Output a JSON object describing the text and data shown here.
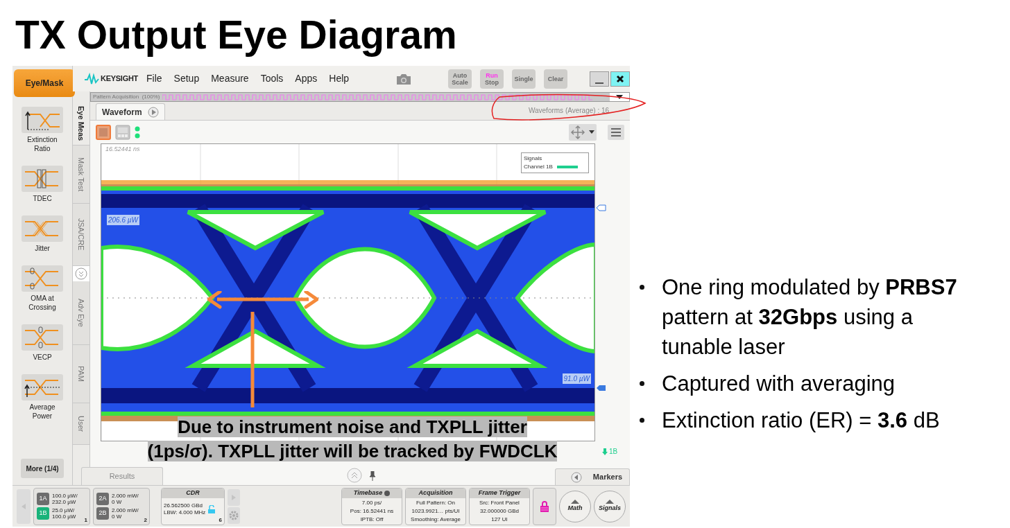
{
  "slide": {
    "title": "TX Output Eye Diagram",
    "bullets": [
      "One ring modulated by **PRBS7** pattern at **32Gbps** using a tunable laser",
      "Captured with averaging",
      "Extinction ratio (ER) = **3.6** dB"
    ],
    "annotation": {
      "lines": [
        "Due to instrument noise and TXPLL jitter",
        "(1ps/σ). TXPLL jitter will be tracked by FWDCLK"
      ]
    }
  },
  "app": {
    "mode_button": "Eye/Mask",
    "logo": "KEYSIGHT",
    "menu": [
      "File",
      "Setup",
      "Measure",
      "Tools",
      "Apps",
      "Help"
    ],
    "buttons": [
      {
        "kind": "plain",
        "lines": [
          "Auto",
          "Scale"
        ]
      },
      {
        "kind": "run_stop",
        "lines": [
          "Run",
          "Stop"
        ],
        "running": true
      },
      {
        "kind": "plain",
        "lines": [
          "Single"
        ]
      },
      {
        "kind": "plain",
        "lines": [
          "Clear"
        ]
      }
    ],
    "measurements": [
      {
        "label": "Extinction Ratio",
        "kind": "extinction"
      },
      {
        "label": "TDEC",
        "kind": "tdec"
      },
      {
        "label": "Jitter",
        "kind": "jitter"
      },
      {
        "label": "OMA at Crossing",
        "kind": "oma"
      },
      {
        "label": "VECP",
        "kind": "vecp"
      },
      {
        "label": "Average Power",
        "kind": "power"
      }
    ],
    "more_button": "More (1/4)",
    "side_tabs": [
      {
        "label": "Eye Meas",
        "selected": true
      },
      {
        "label": "Mask Test",
        "selected": false
      },
      {
        "label": "JSA/CRE",
        "selected": false
      },
      {
        "label": "Adv Eye",
        "selected": false
      },
      {
        "label": "PAM",
        "selected": false
      },
      {
        "label": "User",
        "selected": false
      }
    ],
    "acquisition_bar": "Pattern Acquisition  (100%)",
    "tab": "Waveform",
    "waveform_status": "Waveforms (Average) : 16",
    "plot": {
      "time_label": "16.52441 ns",
      "legend_title": "Signals",
      "legend_items": [
        {
          "label": "Channel 1B",
          "color": "#1fcf8f"
        }
      ],
      "markers": [
        "206.6 µW",
        "91.0 µW"
      ],
      "channel_tag": "1B"
    },
    "bottom_tabs": [
      "Results",
      "Markers"
    ],
    "channel_groups": [
      {
        "number": "1",
        "channels": [
          {
            "id": "1A",
            "values": [
              "100.0 µW/",
              "232.0 µW"
            ],
            "on": false
          },
          {
            "id": "1B",
            "values": [
              "25.0 µW/",
              "100.0 µW"
            ],
            "on": true
          }
        ]
      },
      {
        "number": "2",
        "channels": [
          {
            "id": "2A",
            "values": [
              "2.000 mW/",
              "0 W"
            ],
            "on": false
          },
          {
            "id": "2B",
            "values": [
              "2.000 mW/",
              "0 W"
            ],
            "on": false
          }
        ]
      }
    ],
    "cdr": {
      "title": "CDR",
      "lines": [
        "26.562500 GBd",
        "LBW: 4.000 MHz"
      ],
      "number": "6",
      "locked": false
    },
    "status_boxes": [
      {
        "title": "Timebase",
        "lines": [
          "7.00 ps/",
          "Pos: 16.52441 ns",
          "IPTB: Off"
        ]
      },
      {
        "title": "Acquisition",
        "lines": [
          "Full Pattern: On",
          "1023.9921… pts/UI",
          "Smoothing: Average"
        ]
      },
      {
        "title": "Frame Trigger",
        "lines": [
          "Src: Front Panel",
          "32.000000 GBd",
          "127 UI"
        ]
      }
    ],
    "round_buttons": [
      "Math",
      "Signals"
    ]
  }
}
